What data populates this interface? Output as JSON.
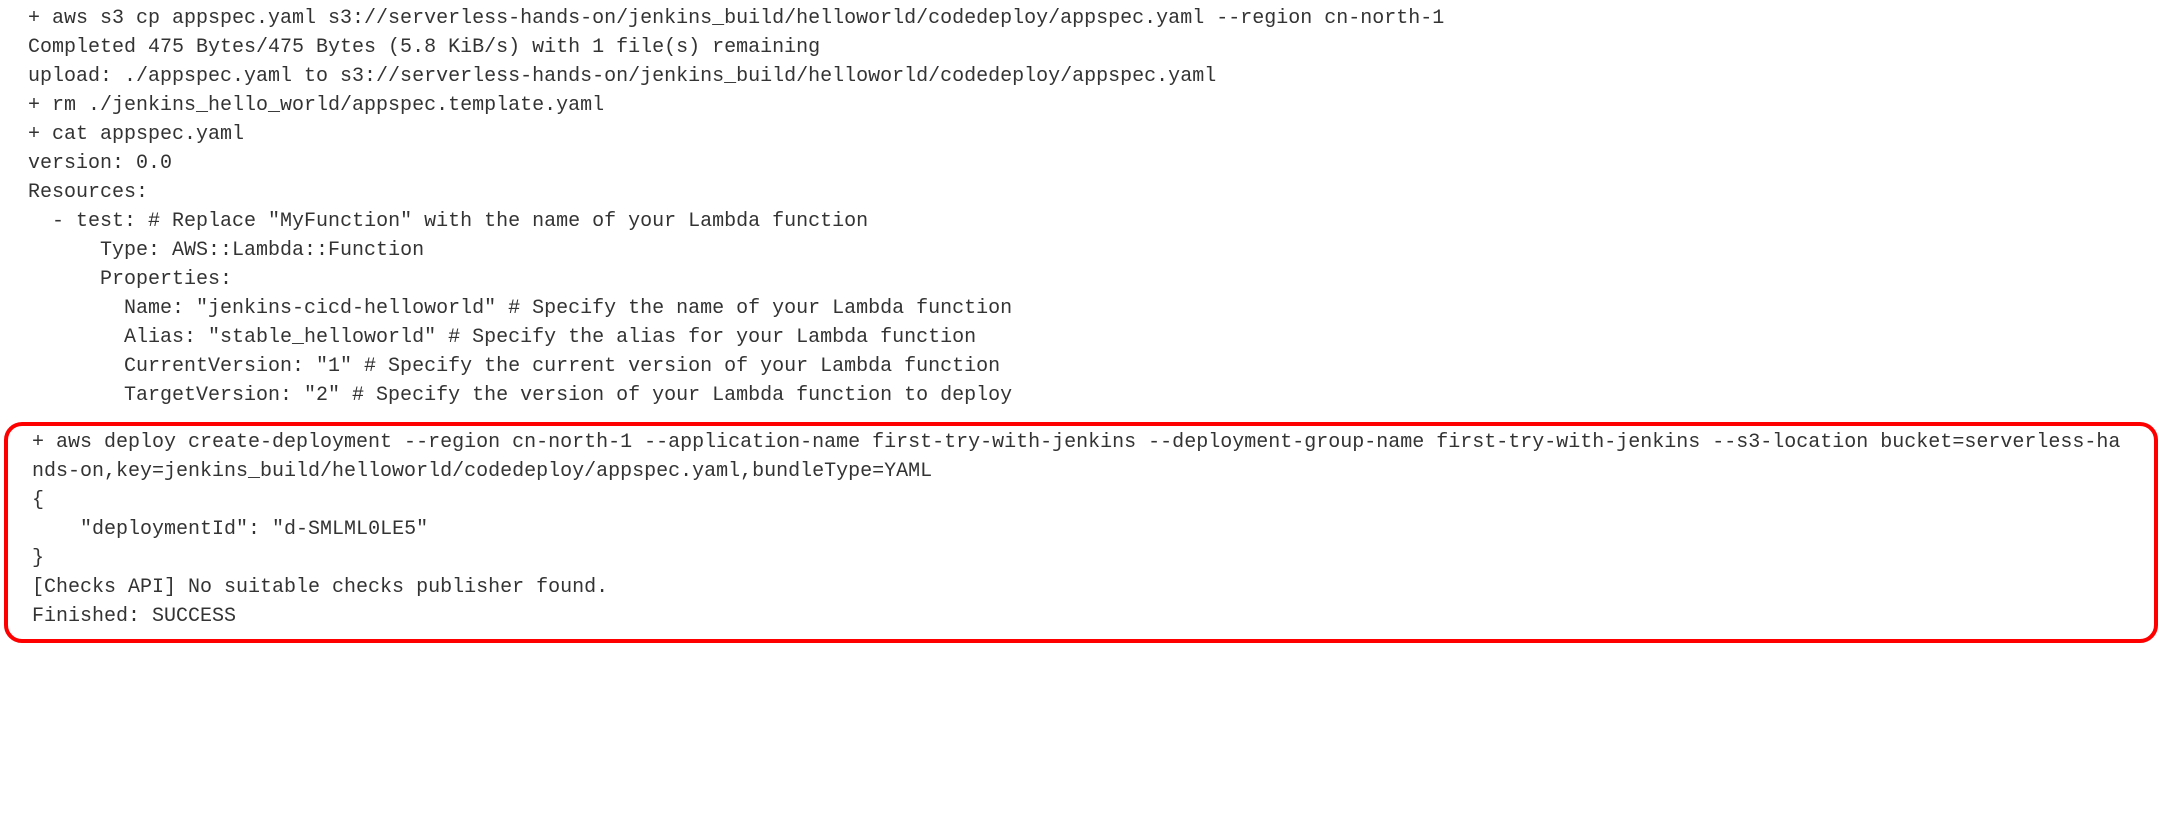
{
  "console": {
    "lines_top": [
      "+ aws s3 cp appspec.yaml s3://serverless-hands-on/jenkins_build/helloworld/codedeploy/appspec.yaml --region cn-north-1",
      "Completed 475 Bytes/475 Bytes (5.8 KiB/s) with 1 file(s) remaining",
      "upload: ./appspec.yaml to s3://serverless-hands-on/jenkins_build/helloworld/codedeploy/appspec.yaml",
      "+ rm ./jenkins_hello_world/appspec.template.yaml",
      "+ cat appspec.yaml",
      "version: 0.0",
      "Resources:",
      "  - test: # Replace \"MyFunction\" with the name of your Lambda function",
      "      Type: AWS::Lambda::Function",
      "      Properties:",
      "        Name: \"jenkins-cicd-helloworld\" # Specify the name of your Lambda function",
      "        Alias: \"stable_helloworld\" # Specify the alias for your Lambda function",
      "        CurrentVersion: \"1\" # Specify the current version of your Lambda function",
      "        TargetVersion: \"2\" # Specify the version of your Lambda function to deploy"
    ],
    "lines_highlighted": [
      "+ aws deploy create-deployment --region cn-north-1 --application-name first-try-with-jenkins --deployment-group-name first-try-with-jenkins --s3-location bucket=serverless-hands-on,key=jenkins_build/helloworld/codedeploy/appspec.yaml,bundleType=YAML",
      "{",
      "    \"deploymentId\": \"d-SMLML0LE5\"",
      "}",
      "[Checks API] No suitable checks publisher found.",
      "Finished: SUCCESS"
    ]
  }
}
